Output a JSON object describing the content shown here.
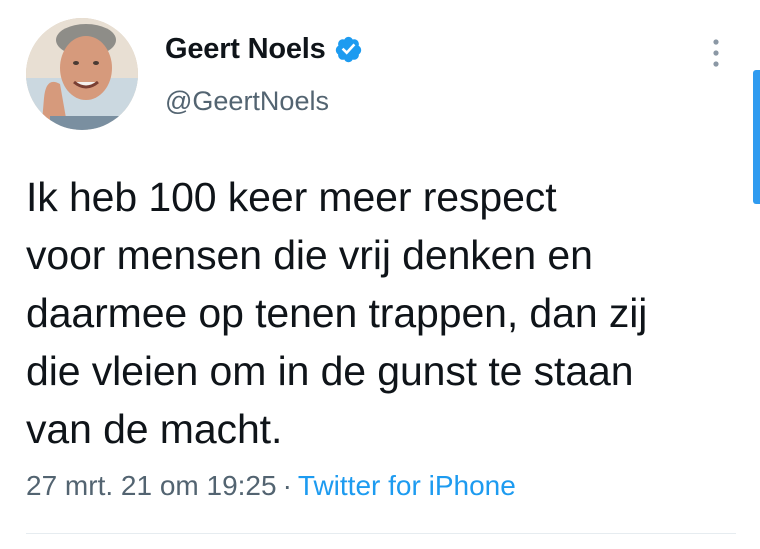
{
  "author": {
    "display_name": "Geert Noels",
    "handle": "@GeertNoels",
    "verified": true,
    "verified_color": "#1d9bf0"
  },
  "tweet": {
    "lines": [
      "Ik heb 100 keer meer respect",
      "voor mensen die vrij denken en",
      "daarmee op tenen trappen, dan zij",
      "die vleien om in de gunst te staan",
      "van de macht."
    ]
  },
  "meta": {
    "timestamp": "27 mrt. 21 om 19:25",
    "separator": "·",
    "source": "Twitter for iPhone"
  },
  "colors": {
    "text": "#0f1419",
    "secondary": "#536471",
    "link": "#1d9bf0"
  },
  "icons": {
    "more": "more-vertical-icon",
    "verified": "verified-badge-icon"
  }
}
